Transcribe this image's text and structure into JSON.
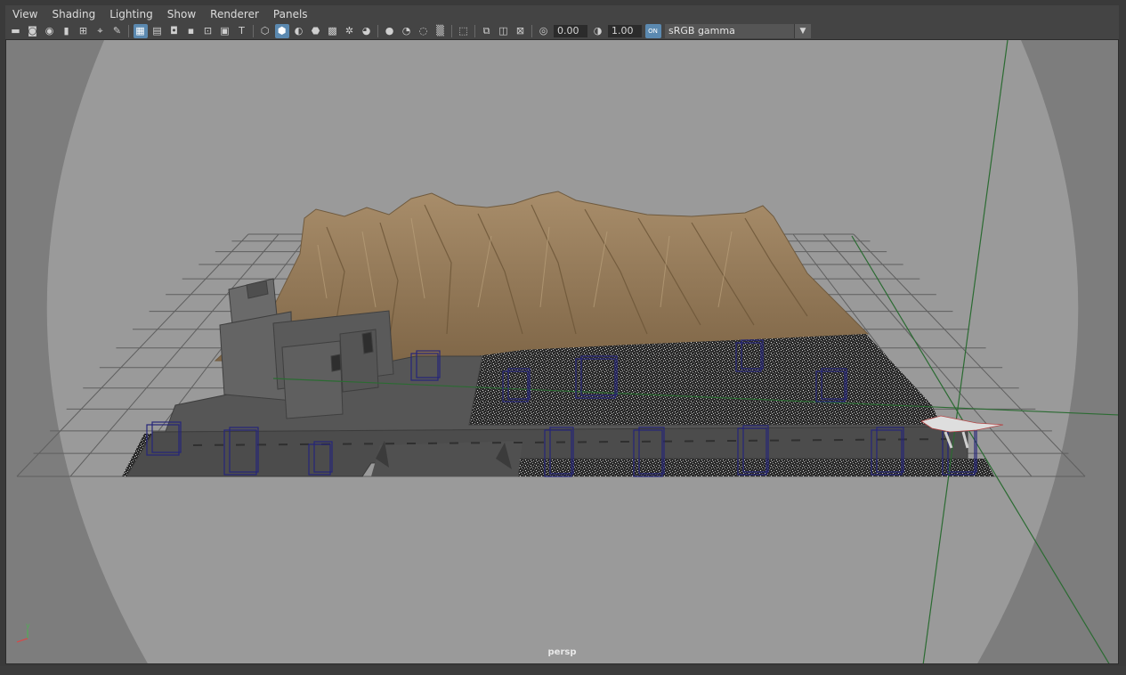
{
  "menubar": {
    "items": [
      "View",
      "Shading",
      "Lighting",
      "Show",
      "Renderer",
      "Panels"
    ]
  },
  "toolbar": {
    "exposure": "0.00",
    "gamma": "1.00",
    "color_management_toggle": "ON",
    "color_space": "sRGB gamma",
    "icons": [
      {
        "name": "select-camera-icon",
        "glyph": "▬",
        "active": false
      },
      {
        "name": "camera-attributes-icon",
        "glyph": "◙",
        "active": false
      },
      {
        "name": "bookmarks-icon",
        "glyph": "◉",
        "active": false
      },
      {
        "name": "bookmark-icon",
        "glyph": "▮",
        "active": false
      },
      {
        "name": "image-plane-icon",
        "glyph": "⊞",
        "active": false
      },
      {
        "name": "two-d-pan-zoom-icon",
        "glyph": "⌖",
        "active": false
      },
      {
        "name": "grease-pencil-icon",
        "glyph": "✎",
        "active": false
      },
      {
        "sep": true
      },
      {
        "name": "grid-icon",
        "glyph": "▦",
        "active": true
      },
      {
        "name": "film-gate-icon",
        "glyph": "▤",
        "active": false
      },
      {
        "name": "resolution-gate-icon",
        "glyph": "◘",
        "active": false
      },
      {
        "name": "gate-mask-icon",
        "glyph": "▪",
        "active": false
      },
      {
        "name": "field-chart-icon",
        "glyph": "⊡",
        "active": false
      },
      {
        "name": "safe-action-icon",
        "glyph": "▣",
        "active": false
      },
      {
        "name": "safe-title-icon",
        "glyph": "T",
        "active": false
      },
      {
        "sep": true
      },
      {
        "name": "wireframe-icon",
        "glyph": "⬡",
        "active": false
      },
      {
        "name": "smooth-shade-icon",
        "glyph": "⬢",
        "active": true
      },
      {
        "name": "default-material-icon",
        "glyph": "◐",
        "active": false
      },
      {
        "name": "wireframe-on-shaded-icon",
        "glyph": "⬣",
        "active": false
      },
      {
        "name": "textured-icon",
        "glyph": "▩",
        "active": false
      },
      {
        "name": "use-all-lights-icon",
        "glyph": "✲",
        "active": false
      },
      {
        "name": "shadows-icon",
        "glyph": "◕",
        "active": false
      },
      {
        "sep": true
      },
      {
        "name": "ambient-occlusion-icon",
        "glyph": "●",
        "active": false
      },
      {
        "name": "motion-blur-icon",
        "glyph": "◔",
        "active": false
      },
      {
        "name": "anti-aliasing-icon",
        "glyph": "◌",
        "active": false
      },
      {
        "name": "depth-of-field-icon",
        "glyph": "▒",
        "active": false
      },
      {
        "sep": true
      },
      {
        "name": "isolate-select-icon",
        "glyph": "⬚",
        "active": false
      },
      {
        "sep": true
      },
      {
        "name": "xray-icon",
        "glyph": "⧉",
        "active": false
      },
      {
        "name": "xray-active-components-icon",
        "glyph": "◫",
        "active": false
      },
      {
        "name": "xray-joints-icon",
        "glyph": "⊠",
        "active": false
      },
      {
        "sep": true
      },
      {
        "name": "exposure-icon",
        "glyph": "◎",
        "active": false
      }
    ],
    "gamma_icon": {
      "name": "gamma-icon",
      "glyph": "◑"
    }
  },
  "viewport": {
    "camera_label": "persp",
    "background_color": "#7d7d7d",
    "gate_color": "#9a9a9a"
  }
}
